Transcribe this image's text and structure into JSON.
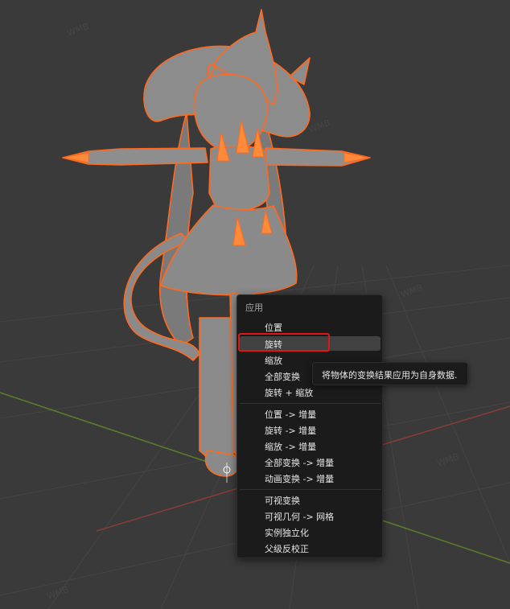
{
  "context_menu": {
    "title": "应用",
    "items": [
      "位置",
      "旋转",
      "缩放",
      "全部变换",
      "旋转 + 缩放",
      "位置 -> 增量",
      "旋转 -> 增量",
      "缩放 -> 增量",
      "全部变换 -> 增量",
      "动画变换 -> 增量",
      "可视变换",
      "可视几何 -> 网格",
      "实例独立化",
      "父级反校正"
    ],
    "hovered_item": "旋转"
  },
  "tooltip": {
    "text": "将物体的变换结果应用为自身数据."
  },
  "colors": {
    "viewport_bg": "#3a3a3a",
    "grid_line": "#444444",
    "x_axis": "#8a3b3b",
    "y_axis": "#5e7f2e",
    "selection_outline": "#ff6a1f",
    "model_gray": "#8c8c8c",
    "menu_bg": "#1b1b1b",
    "menu_hover": "#414141",
    "highlight_box": "#e01616"
  },
  "icons": [
    "origin-cursor-icon"
  ]
}
